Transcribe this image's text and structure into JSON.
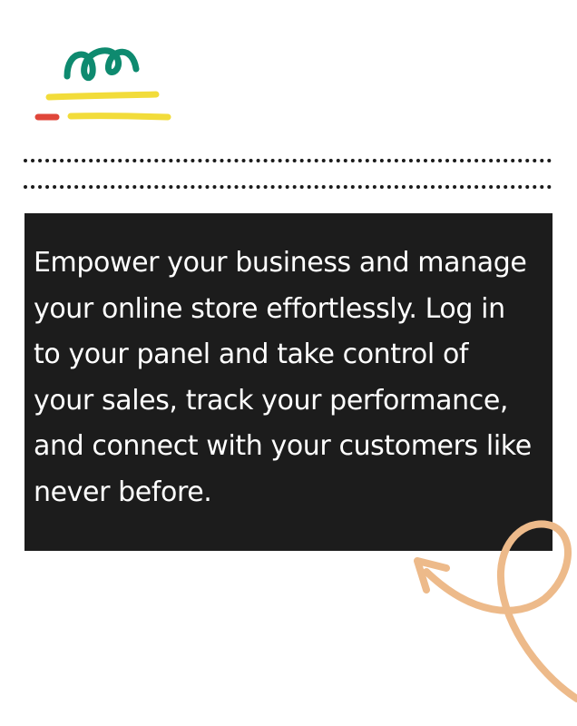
{
  "intro": {
    "text": "Empower your business and manage your online store effortlessly. Log in to your panel and take control of your sales, track your performance, and connect with your customers like never before."
  },
  "decor": {
    "top_doodle": {
      "icon": "scribble-icon",
      "colors": [
        "#0e8a6f",
        "#f2dc3a",
        "#e0463a"
      ]
    },
    "arrow_doodle": {
      "icon": "curly-arrow-icon",
      "color": "#edba8a"
    },
    "card_color": "#1c1c1c",
    "divider_color": "#1b1b1b"
  }
}
